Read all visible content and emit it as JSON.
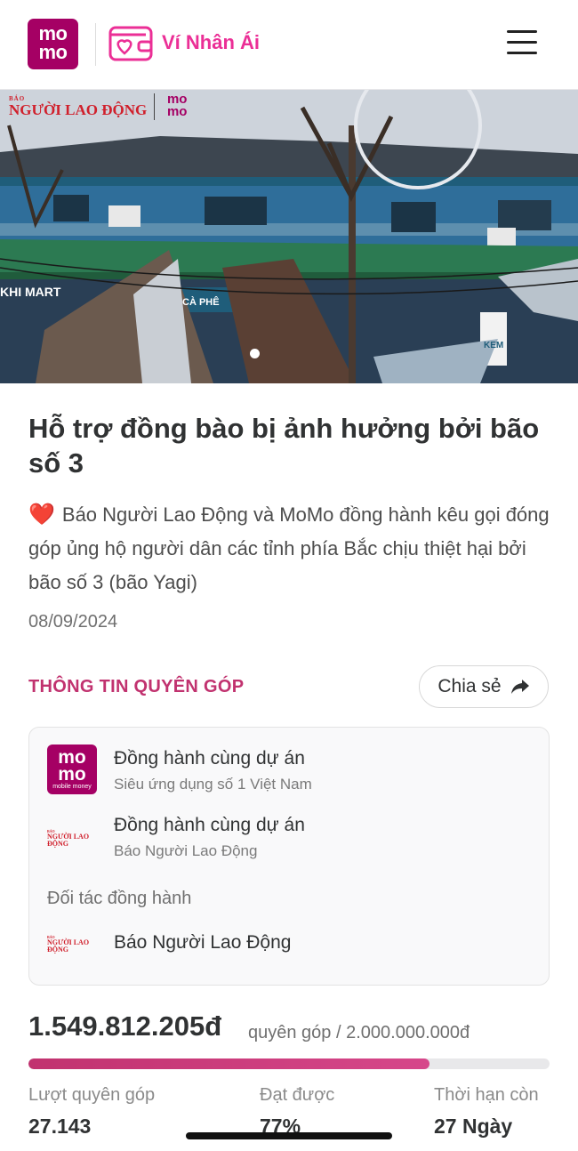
{
  "header": {
    "logo_line1": "mo",
    "logo_line2": "mo",
    "brand_name": "Ví Nhân Ái"
  },
  "banner": {
    "publisher_small": "BÁO",
    "publisher_name": "NGƯỜI LAO ĐỘNG",
    "partner_line1": "mo",
    "partner_line2": "mo",
    "shop_sign": "CÀ PHÊ",
    "shop_sign_left": "KHI MART",
    "shop_sign_right": "KEM"
  },
  "campaign": {
    "title": "Hỗ trợ đồng bào bị ảnh hưởng bởi bão số 3",
    "heart_emoji": "❤️",
    "description": "Báo Người Lao Động và MoMo đồng hành kêu gọi đóng góp ủng hộ người dân các tỉnh phía Bắc chịu thiệt hại bởi bão số 3 (bão Yagi)",
    "date": "08/09/2024"
  },
  "donation_info": {
    "section_title": "THÔNG TIN QUYÊN GÓP",
    "share_label": "Chia sẻ"
  },
  "partners": {
    "companions": [
      {
        "logo_line1": "mo",
        "logo_line2": "mo",
        "logo_caption": "mobile money",
        "name": "Đồng hành cùng dự án",
        "subtitle": "Siêu ứng dụng số 1 Việt Nam"
      },
      {
        "logo_small": "BÁO",
        "logo_text": "NGƯỜI LAO ĐỘNG",
        "name": "Đồng hành cùng dự án",
        "subtitle": "Báo Người Lao Động"
      }
    ],
    "partner_label": "Đối tác đồng hành",
    "partner": {
      "logo_small": "BÁO",
      "logo_text": "NGƯỜI LAO ĐỘNG",
      "name": "Báo Người Lao Động"
    }
  },
  "progress": {
    "raised": "1.549.812.205đ",
    "goal_text": "quyên góp / 2.000.000.000đ",
    "fraction": 0.77
  },
  "stats": {
    "donations_label": "Lượt quyên góp",
    "donations_value": "27.143",
    "achieved_label": "Đạt được",
    "achieved_value": "77%",
    "remaining_label": "Thời hạn còn",
    "remaining_value": "27 Ngày"
  },
  "colors": {
    "brand": "#a50064",
    "accent_pink": "#eb2f96",
    "section_title": "#c1326f",
    "progress_fill": "#c1326f",
    "progress_track": "#e8e8ea"
  },
  "icons": {
    "menu": "hamburger-menu-icon",
    "wallet": "wallet-heart-icon",
    "share": "share-arrow-icon"
  }
}
